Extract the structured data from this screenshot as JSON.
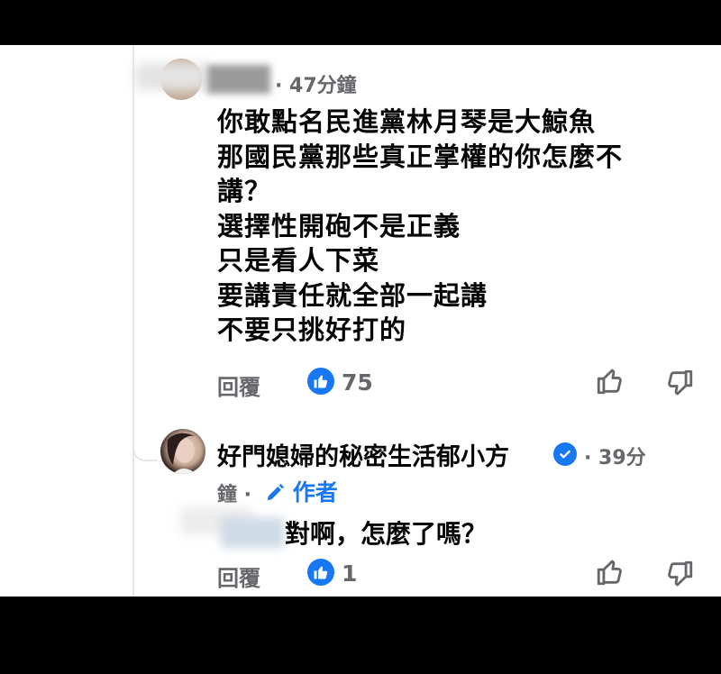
{
  "comment": {
    "timestamp": "· 47分鐘",
    "lines": [
      "你敢點名民進黨林月琴是大鯨魚",
      "那國民黨那些真正掌權的你怎麼不",
      "講？",
      "選擇性開砲不是正義",
      "只是看人下菜",
      "要講責任就全部一起講",
      "不要只挑好打的"
    ],
    "reply_label": "回覆",
    "like_count": "75"
  },
  "reply": {
    "author": "好門媳婦的秘密生活郁小方",
    "timestamp_part1": "· 39分",
    "timestamp_part2": "鐘 ·",
    "author_badge": "作者",
    "text": "對啊，怎麼了嗎？",
    "reply_label": "回覆",
    "like_count": "1"
  },
  "icons": {
    "like_badge": "thumbs-up-icon",
    "like_reaction": "thumbs-up-outline-icon",
    "dislike_reaction": "thumbs-down-outline-icon",
    "verified": "verified-check-icon",
    "author_badge": "pencil-icon"
  },
  "colors": {
    "facebook_blue": "#1877f2",
    "meta_gray": "#65676b",
    "text": "#050505"
  }
}
